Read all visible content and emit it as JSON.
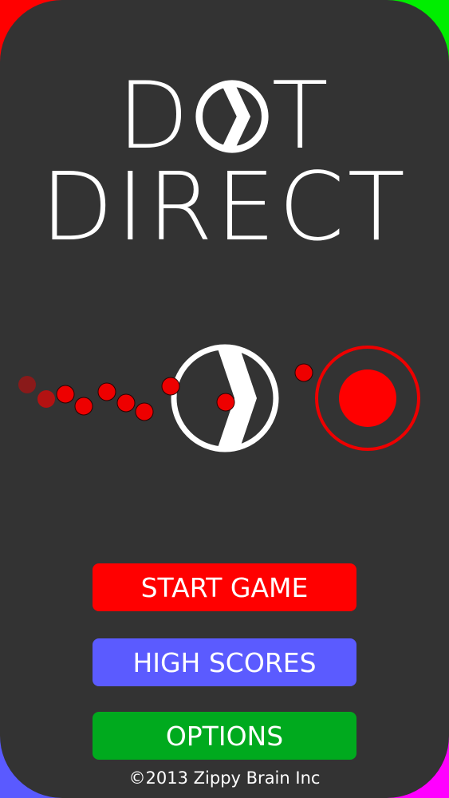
{
  "title": {
    "line1_left": "D",
    "line1_right": "T",
    "line2": "DIRECT"
  },
  "menu": {
    "start_label": "START GAME",
    "scores_label": "HIGH SCORES",
    "options_label": "OPTIONS"
  },
  "footer": {
    "copyright": "©2013 Zippy Brain Inc"
  },
  "colors": {
    "background": "#333333",
    "red": "#ff0000",
    "blue": "#5b5bff",
    "green": "#00aa1e",
    "white": "#ffffff"
  },
  "icons": {
    "title_logo": "circle-chevron-icon",
    "direction": "circle-chevron-icon",
    "target": "target-icon"
  }
}
